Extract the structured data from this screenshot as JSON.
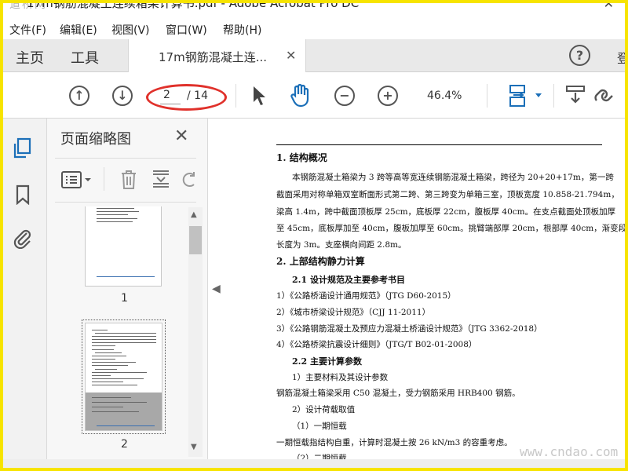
{
  "window": {
    "watermark_logo": "道桥网",
    "title": "17m钢筋混凝土连续箱梁计算书.pdf - Adobe Acrobat Pro DC",
    "close_glyph": "✕"
  },
  "menu": {
    "items": [
      "文件(F)",
      "编辑(E)",
      "视图(V)",
      "窗口(W)",
      "帮助(H)"
    ]
  },
  "tabs": {
    "home": "主页",
    "tools": "工具",
    "document": "17m钢筋混凝土连...",
    "close": "✕",
    "help": "?",
    "signin": "登"
  },
  "toolbar": {
    "current_page": "2",
    "total_pages": "/ 14",
    "zoom": "46.4%",
    "annotation_color": "#e0312b",
    "accent_color": "#1b6fb8"
  },
  "left_strip": {
    "icons": [
      "pages-icon",
      "bookmark-icon",
      "attachment-icon"
    ]
  },
  "thumbnail_panel": {
    "title": "页面缩略图",
    "close": "✕",
    "pages": [
      {
        "number": "1"
      },
      {
        "number": "2"
      }
    ]
  },
  "document": {
    "sections": [
      {
        "kind": "heading",
        "text": "1.  结构概况"
      },
      {
        "kind": "para",
        "text": "本钢筋混凝土箱梁为 3 跨等高等宽连续钢筋混凝土箱梁，跨径为 20+20+17m，第一跨"
      },
      {
        "kind": "para",
        "text": "截面采用对称单箱双室断面形式第二跨、第三跨变为单箱三室，顶板宽度 10.858-21.794m，"
      },
      {
        "kind": "para",
        "text": "梁高 1.4m，跨中截面顶板厚 25cm，底板厚 22cm，腹板厚 40cm。在支点截面处顶板加厚"
      },
      {
        "kind": "para",
        "text": "至 45cm，底板厚加至 40cm，腹板加厚至 60cm。挑臂端部厚 20cm，根部厚 40cm，渐变段"
      },
      {
        "kind": "para",
        "text": "长度为 3m。支座横向间距 2.8m。"
      },
      {
        "kind": "heading",
        "text": "2.  上部结构静力计算"
      },
      {
        "kind": "sub",
        "text": "2.1  设计规范及主要参考书目"
      },
      {
        "kind": "para",
        "text": "1）《公路桥涵设计通用规范》（JTG D60-2015）"
      },
      {
        "kind": "para",
        "text": "2）《城市桥梁设计规范》（CJJ 11-2011）"
      },
      {
        "kind": "para",
        "text": "3）《公路钢筋混凝土及预应力混凝土桥涵设计规范》（JTG 3362-2018）"
      },
      {
        "kind": "para",
        "text": "4）《公路桥梁抗震设计细则》（JTG/T B02-01-2008）"
      },
      {
        "kind": "sub",
        "text": "2.2  主要计算参数"
      },
      {
        "kind": "para",
        "text": "1）主要材料及其设计参数"
      },
      {
        "kind": "para",
        "text": "钢筋混凝土箱梁采用 C50 混凝土，受力钢筋采用 HRB400 钢筋。"
      },
      {
        "kind": "para",
        "text": "2）设计荷载取值"
      },
      {
        "kind": "para",
        "text": "（1）一期恒载"
      },
      {
        "kind": "para",
        "text": "一期恒载指结构自重，计算时混凝土按 26  kN/m3 的容重考虑。"
      },
      {
        "kind": "para",
        "text": "（2）二期恒载"
      }
    ]
  },
  "watermark_bottom": "www.cndao.com"
}
